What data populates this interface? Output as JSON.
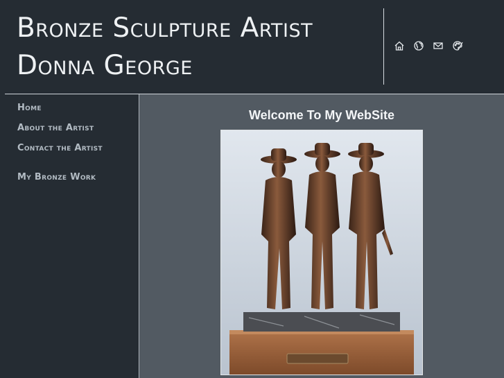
{
  "header": {
    "title_line1": "Bronze Sculpture Artist",
    "title_line2": "Donna George",
    "icons": [
      "home-icon",
      "globe-icon",
      "mail-icon",
      "palette-icon"
    ]
  },
  "sidebar": {
    "items": [
      {
        "label": "Home"
      },
      {
        "label": "About the Artist"
      },
      {
        "label": "Contact the Artist"
      },
      {
        "label": "My Bronze Work"
      }
    ]
  },
  "main": {
    "heading": "Welcome To My WebSite"
  },
  "colors": {
    "background": "#252c33",
    "content": "#525a62",
    "nav_text": "#b3bcc4",
    "title_text": "#eef1f3"
  }
}
